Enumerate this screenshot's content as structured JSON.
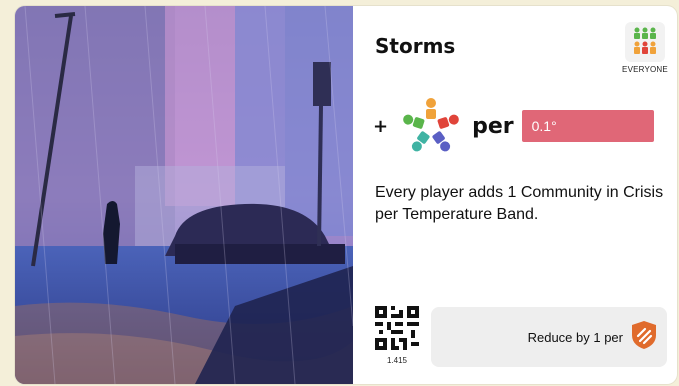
{
  "card": {
    "title": "Storms",
    "badge_label": "EVERYONE",
    "cost_plus": "+",
    "per_label": "per",
    "temperature_band": "0.1°",
    "description": "Every player adds 1 Community in Crisis per Temperature Band.",
    "qr_code": "1.415",
    "reduce_label": "Reduce by 1 per",
    "icons": {
      "art": "storm-flood-illustration",
      "badge": "everyone-players-icon",
      "community": "community-in-crisis-icon",
      "qr": "qr-code-icon",
      "reduce": "shield-icon"
    },
    "colors": {
      "temperature_band": "#e06777",
      "shield": "#e06b2c",
      "badge_green": "#5ab54b",
      "badge_orange": "#f0a23a",
      "badge_red": "#e0443a"
    }
  }
}
